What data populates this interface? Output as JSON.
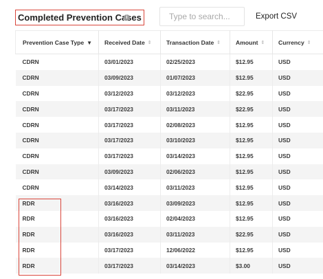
{
  "header": {
    "title": "Completed Prevention Cases",
    "info_icon": "info-icon",
    "info_glyph": "i",
    "search_placeholder": "Type to search...",
    "export_label": "Export CSV"
  },
  "table": {
    "columns": [
      {
        "label": "Prevention Case Type",
        "sort_icon": "sort-desc-icon",
        "glyph": "▼"
      },
      {
        "label": "Received Date",
        "sort_icon": "sort-icon",
        "glyph": "⇕"
      },
      {
        "label": "Transaction Date",
        "sort_icon": "sort-icon",
        "glyph": "⇕"
      },
      {
        "label": "Amount",
        "sort_icon": "sort-icon",
        "glyph": "⇕"
      },
      {
        "label": "Currency",
        "sort_icon": "sort-icon",
        "glyph": "⇕"
      }
    ],
    "rows": [
      [
        "CDRN",
        "03/01/2023",
        "02/25/2023",
        "$12.95",
        "USD"
      ],
      [
        "CDRN",
        "03/09/2023",
        "01/07/2023",
        "$12.95",
        "USD"
      ],
      [
        "CDRN",
        "03/12/2023",
        "03/12/2023",
        "$22.95",
        "USD"
      ],
      [
        "CDRN",
        "03/17/2023",
        "03/11/2023",
        "$22.95",
        "USD"
      ],
      [
        "CDRN",
        "03/17/2023",
        "02/08/2023",
        "$12.95",
        "USD"
      ],
      [
        "CDRN",
        "03/17/2023",
        "03/10/2023",
        "$12.95",
        "USD"
      ],
      [
        "CDRN",
        "03/17/2023",
        "03/14/2023",
        "$12.95",
        "USD"
      ],
      [
        "CDRN",
        "03/09/2023",
        "02/06/2023",
        "$12.95",
        "USD"
      ],
      [
        "CDRN",
        "03/14/2023",
        "03/11/2023",
        "$12.95",
        "USD"
      ],
      [
        "RDR",
        "03/16/2023",
        "03/09/2023",
        "$12.95",
        "USD"
      ],
      [
        "RDR",
        "03/16/2023",
        "02/04/2023",
        "$12.95",
        "USD"
      ],
      [
        "RDR",
        "03/16/2023",
        "03/11/2023",
        "$22.95",
        "USD"
      ],
      [
        "RDR",
        "03/17/2023",
        "12/06/2022",
        "$12.95",
        "USD"
      ],
      [
        "RDR",
        "03/17/2023",
        "03/14/2023",
        "$3.00",
        "USD"
      ]
    ]
  },
  "colors": {
    "highlight": "#d9453a",
    "stripe": "#f4f4f4"
  }
}
